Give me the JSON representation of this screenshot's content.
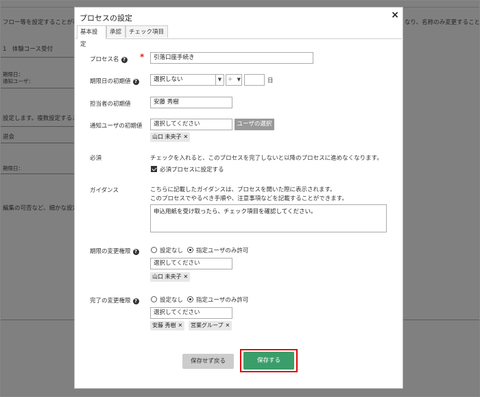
{
  "background": {
    "line1": "フロー等を設定することが可能",
    "line1_right": "なり、名称のみ変更することが",
    "line2": "1　体験コース受付",
    "line3": "期限日：",
    "line4": "通知ユーザ：",
    "line5": "設定します。複数設定するこ",
    "line6": "退会",
    "line7": "期限日：",
    "line8": "編集の可否など、細かな設定"
  },
  "modal": {
    "title": "プロセスの設定",
    "close": "×",
    "tabs": [
      {
        "label": "基本設定"
      },
      {
        "label": "承認"
      },
      {
        "label": "チェック項目"
      }
    ]
  },
  "form": {
    "process_name": {
      "label": "プロセス名",
      "required": "*",
      "value": "引落口座手続き"
    },
    "deadline": {
      "label": "期限日の初期値",
      "select": "選択しない",
      "plus": "+",
      "day_value": "",
      "unit": "日"
    },
    "assignee": {
      "label": "担当者の初期値",
      "value": "安藤 秀樹"
    },
    "notify": {
      "label": "通知ユーザの初期値",
      "placeholder": "選択してください",
      "button": "ユーザの選択",
      "chips": [
        "山口 未央子"
      ]
    },
    "mandatory": {
      "label": "必須",
      "description": "チェックを入れると、このプロセスを完了しないと以降のプロセスに進めなくなります。",
      "checkbox_label": "必須プロセスに設定する"
    },
    "guidance": {
      "label": "ガイダンス",
      "desc1": "こちらに記載したガイダンスは、プロセスを開いた際に表示されます。",
      "desc2": "このプロセスでやるべき手順や、注意事項などを記載することができます。",
      "value": "申込用紙を受け取ったら、チェック項目を確認してください。"
    },
    "deadline_perm": {
      "label": "期限の変更権限",
      "opt1": "設定なし",
      "opt2": "指定ユーザのみ許可",
      "placeholder": "選択してください",
      "chips": [
        "山口 未央子"
      ]
    },
    "complete_perm": {
      "label": "完了の変更権限",
      "opt1": "設定なし",
      "opt2": "指定ユーザのみ許可",
      "placeholder": "選択してください",
      "chips": [
        "安藤 秀樹",
        "営業グループ"
      ]
    }
  },
  "actions": {
    "cancel": "保存せず戻る",
    "save": "保存する"
  },
  "help_glyph": "?",
  "colors": {
    "save": "#3a9e6a",
    "highlight": "#e00000",
    "required": "#dd2222"
  }
}
